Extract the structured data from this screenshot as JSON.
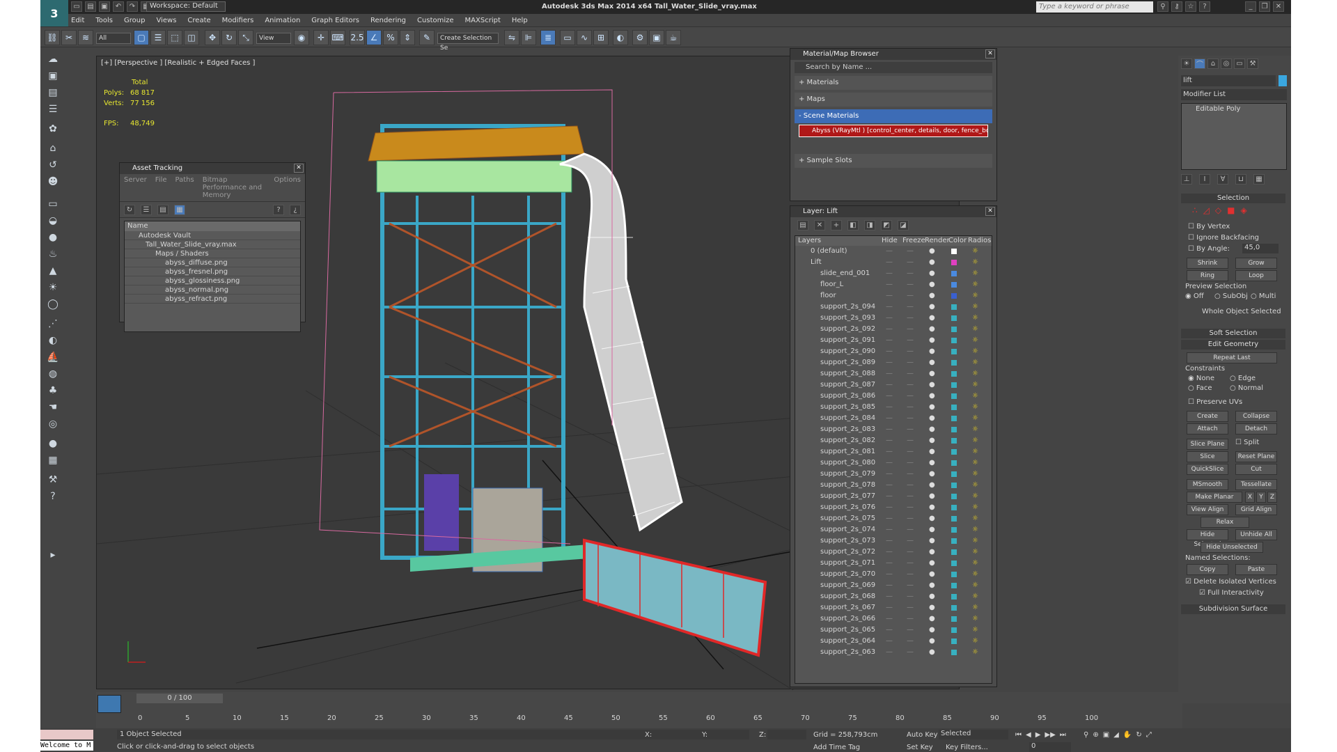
{
  "app": {
    "title": "Autodesk 3ds Max  2014 x64     Tall_Water_Slide_vray.max",
    "workspace": "Workspace: Default",
    "search_placeholder": "Type a keyword or phrase",
    "logo": "3"
  },
  "menu": [
    "Edit",
    "Tools",
    "Group",
    "Views",
    "Create",
    "Modifiers",
    "Animation",
    "Graph Editors",
    "Rendering",
    "Customize",
    "MAXScript",
    "Help"
  ],
  "toolbar": {
    "filter": "All",
    "refcoord": "View",
    "named_sel": "Create Selection Se",
    "snap": "2.5"
  },
  "viewport": {
    "label": "[+] [Perspective ] [Realistic + Edged Faces ]",
    "stats": {
      "total_label": "Total",
      "polys_label": "Polys:",
      "polys": "68 817",
      "verts_label": "Verts:",
      "verts": "77 156",
      "fps_label": "FPS:",
      "fps": "48,749"
    }
  },
  "asset_tracking": {
    "title": "Asset Tracking",
    "menu": [
      "Server",
      "File",
      "Paths",
      "Bitmap Performance and Memory",
      "Options"
    ],
    "col": "Name",
    "items": [
      "Autodesk Vault",
      "Tall_Water_Slide_vray.max",
      "Maps / Shaders",
      "abyss_diffuse.png",
      "abyss_fresnel.png",
      "abyss_glossiness.png",
      "abyss_normal.png",
      "abyss_refract.png"
    ]
  },
  "material_browser": {
    "title": "Material/Map Browser",
    "search": "Search by Name ...",
    "sections": [
      "+ Materials",
      "+ Maps",
      "- Scene Materials",
      "+ Sample Slots"
    ],
    "material": "Abyss  (VRayMtl ) [control_center, details, door, fence_bottom..."
  },
  "layer": {
    "title": "Layer: Lift",
    "cols": [
      "Layers",
      "Hide",
      "Freeze",
      "Render",
      "Color",
      "Radios"
    ],
    "rows": [
      {
        "n": "0 (default)",
        "c": "#ffffff"
      },
      {
        "n": "Lift",
        "c": "#e040c0"
      },
      {
        "n": "slide_end_001",
        "c": "#4a8ae0"
      },
      {
        "n": "floor_L",
        "c": "#4a8ae0"
      },
      {
        "n": "floor",
        "c": "#3a60d0"
      },
      {
        "n": "support_2s_094",
        "c": "#38b0c0"
      },
      {
        "n": "support_2s_093",
        "c": "#38b0c0"
      },
      {
        "n": "support_2s_092",
        "c": "#38b0c0"
      },
      {
        "n": "support_2s_091",
        "c": "#38b0c0"
      },
      {
        "n": "support_2s_090",
        "c": "#38b0c0"
      },
      {
        "n": "support_2s_089",
        "c": "#38b0c0"
      },
      {
        "n": "support_2s_088",
        "c": "#38b0c0"
      },
      {
        "n": "support_2s_087",
        "c": "#38b0c0"
      },
      {
        "n": "support_2s_086",
        "c": "#38b0c0"
      },
      {
        "n": "support_2s_085",
        "c": "#38b0c0"
      },
      {
        "n": "support_2s_084",
        "c": "#38b0c0"
      },
      {
        "n": "support_2s_083",
        "c": "#38b0c0"
      },
      {
        "n": "support_2s_082",
        "c": "#38b0c0"
      },
      {
        "n": "support_2s_081",
        "c": "#38b0c0"
      },
      {
        "n": "support_2s_080",
        "c": "#38b0c0"
      },
      {
        "n": "support_2s_079",
        "c": "#38b0c0"
      },
      {
        "n": "support_2s_078",
        "c": "#38b0c0"
      },
      {
        "n": "support_2s_077",
        "c": "#38b0c0"
      },
      {
        "n": "support_2s_076",
        "c": "#38b0c0"
      },
      {
        "n": "support_2s_075",
        "c": "#38b0c0"
      },
      {
        "n": "support_2s_074",
        "c": "#38b0c0"
      },
      {
        "n": "support_2s_073",
        "c": "#38b0c0"
      },
      {
        "n": "support_2s_072",
        "c": "#38b0c0"
      },
      {
        "n": "support_2s_071",
        "c": "#38b0c0"
      },
      {
        "n": "support_2s_070",
        "c": "#38b0c0"
      },
      {
        "n": "support_2s_069",
        "c": "#38b0c0"
      },
      {
        "n": "support_2s_068",
        "c": "#38b0c0"
      },
      {
        "n": "support_2s_067",
        "c": "#38b0c0"
      },
      {
        "n": "support_2s_066",
        "c": "#38b0c0"
      },
      {
        "n": "support_2s_065",
        "c": "#38b0c0"
      },
      {
        "n": "support_2s_064",
        "c": "#38b0c0"
      },
      {
        "n": "support_2s_063",
        "c": "#38b0c0"
      }
    ]
  },
  "right_panel": {
    "name": "lift",
    "modifier_list": "Modifier List",
    "stack_item": "Editable Poly",
    "selection": "Selection",
    "by_vertex": "By Vertex",
    "ignore_backfacing": "Ignore Backfacing",
    "by_angle": "By Angle:",
    "angle": "45,0",
    "shrink": "Shrink",
    "grow": "Grow",
    "ring": "Ring",
    "loop": "Loop",
    "preview_selection": "Preview Selection",
    "off": "Off",
    "subobj": "SubObj",
    "multi": "Multi",
    "whole": "Whole Object Selected",
    "soft_selection": "Soft Selection",
    "edit_geometry": "Edit Geometry",
    "repeat_last": "Repeat Last",
    "constraints": "Constraints",
    "none": "None",
    "edge": "Edge",
    "face": "Face",
    "normal": "Normal",
    "preserve_uvs": "Preserve UVs",
    "create": "Create",
    "collapse": "Collapse",
    "attach": "Attach",
    "detach": "Detach",
    "slice_plane": "Slice Plane",
    "split": "Split",
    "slice": "Slice",
    "reset_plane": "Reset Plane",
    "quickslice": "QuickSlice",
    "cut": "Cut",
    "msmooth": "MSmooth",
    "tessellate": "Tessellate",
    "make_planar": "Make Planar",
    "x": "X",
    "y": "Y",
    "z": "Z",
    "view_align": "View Align",
    "grid_align": "Grid Align",
    "relax": "Relax",
    "hide_selected": "Hide Selected",
    "unhide_all": "Unhide All",
    "hide_unselected": "Hide Unselected",
    "named_selections": "Named Selections:",
    "copy": "Copy",
    "paste": "Paste",
    "delete_isolated": "Delete Isolated Vertices",
    "full_interactivity": "Full Interactivity",
    "subdivision_surface": "Subdivision Surface"
  },
  "timeline": {
    "frame": "0 / 100",
    "ticks": [
      "0",
      "5",
      "10",
      "15",
      "20",
      "25",
      "30",
      "35",
      "40",
      "45",
      "50",
      "55",
      "60",
      "65",
      "70",
      "75",
      "80",
      "85",
      "90",
      "95",
      "100"
    ]
  },
  "status": {
    "welcome": "Welcome to M",
    "selected": "1 Object Selected",
    "prompt": "Click or click-and-drag to select objects",
    "x_label": "X:",
    "y_label": "Y:",
    "z_label": "Z:",
    "grid": "Grid = 258,793cm",
    "add_time_tag": "Add Time Tag",
    "auto_key": "Auto Key",
    "set_key": "Set Key",
    "selected_mode": "Selected",
    "key_filters": "Key Filters...",
    "frame_value": "0"
  }
}
